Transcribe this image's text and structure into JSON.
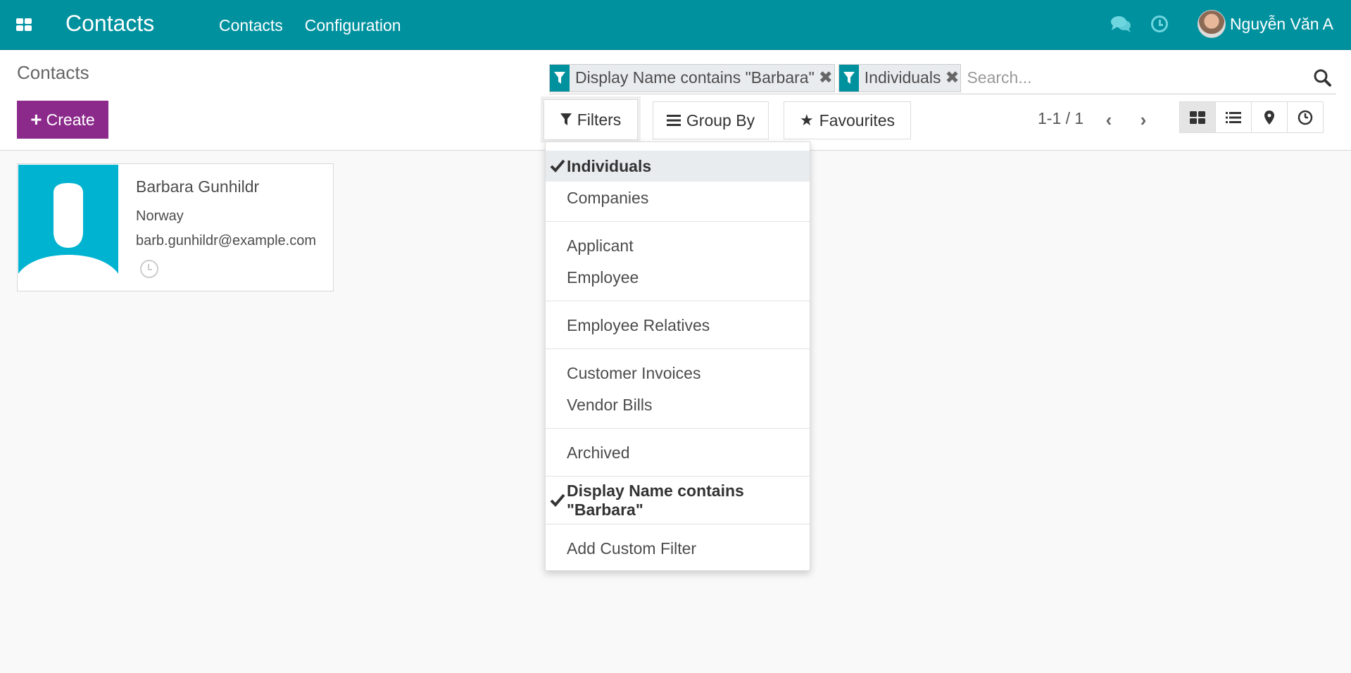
{
  "navbar": {
    "app_title": "Contacts",
    "menu": [
      "Contacts",
      "Configuration"
    ],
    "user_name": "Nguyễn Văn A"
  },
  "control_panel": {
    "breadcrumb": "Contacts",
    "create_label": "Create",
    "facets": [
      {
        "label": "Display Name contains \"Barbara\""
      },
      {
        "label": "Individuals"
      }
    ],
    "search_placeholder": "Search...",
    "filters_label": "Filters",
    "groupby_label": "Group By",
    "favourites_label": "Favourites",
    "pager": "1-1 / 1"
  },
  "kanban": {
    "cards": [
      {
        "name": "Barbara Gunhildr",
        "country": "Norway",
        "email": "barb.gunhildr@example.com"
      }
    ]
  },
  "filters_dropdown": {
    "items": [
      {
        "label": "Individuals",
        "checked": true
      },
      {
        "label": "Companies",
        "checked": false
      },
      {
        "label": "Applicant",
        "checked": false
      },
      {
        "label": "Employee",
        "checked": false
      },
      {
        "label": "Employee Relatives",
        "checked": false
      },
      {
        "label": "Customer Invoices",
        "checked": false
      },
      {
        "label": "Vendor Bills",
        "checked": false
      },
      {
        "label": "Archived",
        "checked": false
      },
      {
        "label": "Display Name contains \"Barbara\"",
        "checked": true
      },
      {
        "label": "Add Custom Filter",
        "checked": false
      }
    ]
  },
  "colors": {
    "navbar": "#00919f",
    "primary_button": "#8b2a8b",
    "avatar_placeholder": "#00b3d1"
  }
}
